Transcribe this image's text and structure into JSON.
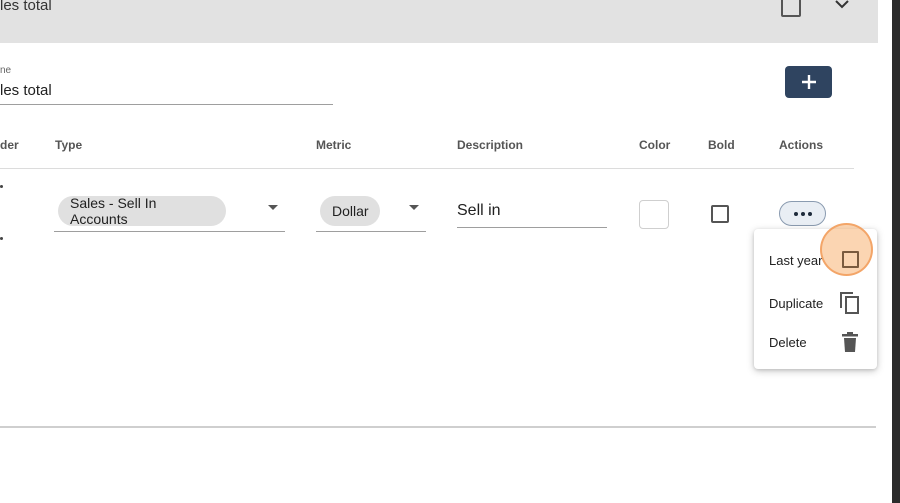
{
  "section": {
    "title": "les total"
  },
  "form": {
    "name_label": "ne",
    "name_value": "les total",
    "add_button_icon": "plus-icon"
  },
  "table": {
    "columns": {
      "order": "der",
      "type": "Type",
      "metric": "Metric",
      "description": "Description",
      "color": "Color",
      "bold": "Bold",
      "actions": "Actions"
    },
    "row": {
      "type": "Sales - Sell In Accounts",
      "metric": "Dollar",
      "description": "Sell in",
      "color": "#ffffff",
      "bold": false
    }
  },
  "menu": {
    "items": [
      {
        "label": "Last year",
        "icon": "checkbox-icon"
      },
      {
        "label": "Duplicate",
        "icon": "copy-icon"
      },
      {
        "label": "Delete",
        "icon": "trash-icon"
      }
    ]
  },
  "colors": {
    "header_bg": "#e2e2e2",
    "add_button": "#2f4460",
    "highlight": "#f7b273"
  }
}
